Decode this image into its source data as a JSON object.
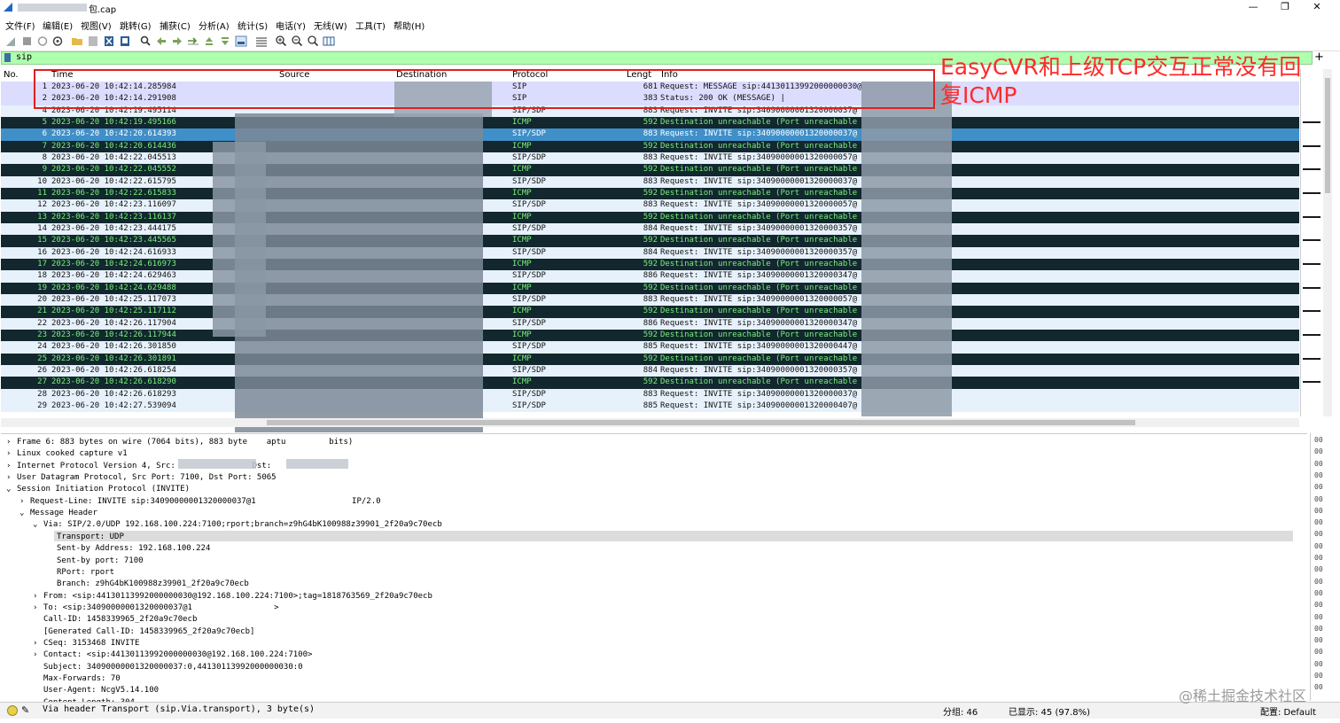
{
  "window": {
    "title": "包.cap",
    "controls": [
      "—",
      "❐",
      "✕"
    ]
  },
  "menu": [
    "文件(F)",
    "编辑(E)",
    "视图(V)",
    "跳转(G)",
    "捕获(C)",
    "分析(A)",
    "统计(S)",
    "电话(Y)",
    "无线(W)",
    "工具(T)",
    "帮助(H)"
  ],
  "filter": {
    "value": "sip",
    "add_label": "+"
  },
  "packet_list": {
    "columns": {
      "no": "No.",
      "time": "Time",
      "source": "Source",
      "destination": "Destination",
      "protocol": "Protocol",
      "length": "Lengt",
      "info": "Info"
    },
    "rows": [
      {
        "no": "1",
        "time": "2023-06-20 10:42:14.285984",
        "proto": "SIP",
        "len": "681",
        "info": "Request: MESSAGE sip:44130113992000000030@",
        "style": "sip"
      },
      {
        "no": "2",
        "time": "2023-06-20 10:42:14.291908",
        "proto": "SIP",
        "len": "383",
        "info": "Status: 200 OK (MESSAGE) |",
        "style": "sip"
      },
      {
        "no": "4",
        "time": "2023-06-20 10:42:19.495114",
        "proto": "SIP/SDP",
        "len": "883",
        "info": "Request: INVITE sip:34090000001320000037@",
        "style": "sip"
      },
      {
        "no": "5",
        "time": "2023-06-20 10:42:19.495166",
        "proto": "ICMP",
        "len": "592",
        "info": "Destination unreachable (Port unreachable",
        "style": "icmp"
      },
      {
        "no": "6",
        "time": "2023-06-20 10:42:20.614393",
        "proto": "SIP/SDP",
        "len": "883",
        "info": "Request: INVITE sip:34090000001320000037@",
        "style": "sel"
      },
      {
        "no": "7",
        "time": "2023-06-20 10:42:20.614436",
        "proto": "ICMP",
        "len": "592",
        "info": "Destination unreachable (Port unreachable",
        "style": "icmp"
      },
      {
        "no": "8",
        "time": "2023-06-20 10:42:22.045513",
        "proto": "SIP/SDP",
        "len": "883",
        "info": "Request: INVITE sip:34090000001320000057@",
        "style": "sip"
      },
      {
        "no": "9",
        "time": "2023-06-20 10:42:22.045552",
        "proto": "ICMP",
        "len": "592",
        "info": "Destination unreachable (Port unreachable",
        "style": "icmp"
      },
      {
        "no": "10",
        "time": "2023-06-20 10:42:22.615795",
        "proto": "SIP/SDP",
        "len": "883",
        "info": "Request: INVITE sip:34090000001320000037@",
        "style": "sip"
      },
      {
        "no": "11",
        "time": "2023-06-20 10:42:22.615833",
        "proto": "ICMP",
        "len": "592",
        "info": "Destination unreachable (Port unreachable",
        "style": "icmp"
      },
      {
        "no": "12",
        "time": "2023-06-20 10:42:23.116097",
        "proto": "SIP/SDP",
        "len": "883",
        "info": "Request: INVITE sip:34090000001320000057@",
        "style": "sip"
      },
      {
        "no": "13",
        "time": "2023-06-20 10:42:23.116137",
        "proto": "ICMP",
        "len": "592",
        "info": "Destination unreachable (Port unreachable",
        "style": "icmp"
      },
      {
        "no": "14",
        "time": "2023-06-20 10:42:23.444175",
        "proto": "SIP/SDP",
        "len": "884",
        "info": "Request: INVITE sip:34090000001320000357@",
        "style": "sip"
      },
      {
        "no": "15",
        "time": "2023-06-20 10:42:23.445565",
        "proto": "ICMP",
        "len": "592",
        "info": "Destination unreachable (Port unreachable",
        "style": "icmp"
      },
      {
        "no": "16",
        "time": "2023-06-20 10:42:24.616933",
        "proto": "SIP/SDP",
        "len": "884",
        "info": "Request: INVITE sip:34090000001320000357@",
        "style": "sip"
      },
      {
        "no": "17",
        "time": "2023-06-20 10:42:24.616973",
        "proto": "ICMP",
        "len": "592",
        "info": "Destination unreachable (Port unreachable",
        "style": "icmp"
      },
      {
        "no": "18",
        "time": "2023-06-20 10:42:24.629463",
        "proto": "SIP/SDP",
        "len": "886",
        "info": "Request: INVITE sip:34090000001320000347@",
        "style": "sip"
      },
      {
        "no": "19",
        "time": "2023-06-20 10:42:24.629488",
        "proto": "ICMP",
        "len": "592",
        "info": "Destination unreachable (Port unreachable",
        "style": "icmp"
      },
      {
        "no": "20",
        "time": "2023-06-20 10:42:25.117073",
        "proto": "SIP/SDP",
        "len": "883",
        "info": "Request: INVITE sip:34090000001320000057@",
        "style": "sip"
      },
      {
        "no": "21",
        "time": "2023-06-20 10:42:25.117112",
        "proto": "ICMP",
        "len": "592",
        "info": "Destination unreachable (Port unreachable",
        "style": "icmp"
      },
      {
        "no": "22",
        "time": "2023-06-20 10:42:26.117904",
        "proto": "SIP/SDP",
        "len": "886",
        "info": "Request: INVITE sip:34090000001320000347@",
        "style": "sip"
      },
      {
        "no": "23",
        "time": "2023-06-20 10:42:26.117944",
        "proto": "ICMP",
        "len": "592",
        "info": "Destination unreachable (Port unreachable",
        "style": "icmp"
      },
      {
        "no": "24",
        "time": "2023-06-20 10:42:26.301850",
        "proto": "SIP/SDP",
        "len": "885",
        "info": "Request: INVITE sip:34090000001320000447@",
        "style": "sip"
      },
      {
        "no": "25",
        "time": "2023-06-20 10:42:26.301891",
        "proto": "ICMP",
        "len": "592",
        "info": "Destination unreachable (Port unreachable",
        "style": "icmp"
      },
      {
        "no": "26",
        "time": "2023-06-20 10:42:26.618254",
        "proto": "SIP/SDP",
        "len": "884",
        "info": "Request: INVITE sip:34090000001320000357@",
        "style": "sip"
      },
      {
        "no": "27",
        "time": "2023-06-20 10:42:26.618290",
        "proto": "ICMP",
        "len": "592",
        "info": "Destination unreachable (Port unreachable",
        "style": "icmp"
      },
      {
        "no": "28",
        "time": "2023-06-20 10:42:26.618293",
        "proto": "SIP/SDP",
        "len": "883",
        "info": "Request: INVITE sip:34090000001320000037@",
        "style": "sip"
      },
      {
        "no": "29",
        "time": "2023-06-20 10:42:27.539094",
        "proto": "SIP/SDP",
        "len": "885",
        "info": "Request: INVITE sip:34090000001320000407@",
        "style": "sip"
      }
    ]
  },
  "annotation": {
    "text": "EasyCVR和上级TCP交互正常没有回复ICMP",
    "color": "#ff2a2a"
  },
  "details": [
    {
      "indent": 0,
      "arrow": "›",
      "text": "Frame 6: 883 bytes on wire (7064 bits), 883 byte    aptu         bits)"
    },
    {
      "indent": 0,
      "arrow": "›",
      "text": "Linux cooked capture v1"
    },
    {
      "indent": 0,
      "arrow": "›",
      "text": "Internet Protocol Version 4, Src:                Dst:"
    },
    {
      "indent": 0,
      "arrow": "›",
      "text": "User Datagram Protocol, Src Port: 7100, Dst Port: 5065"
    },
    {
      "indent": 0,
      "arrow": "⌄",
      "text": "Session Initiation Protocol (INVITE)"
    },
    {
      "indent": 1,
      "arrow": "›",
      "text": "Request-Line: INVITE sip:34090000001320000037@1                    IP/2.0"
    },
    {
      "indent": 1,
      "arrow": "⌄",
      "text": "Message Header"
    },
    {
      "indent": 2,
      "arrow": "⌄",
      "text": "Via: SIP/2.0/UDP 192.168.100.224:7100;rport;branch=z9hG4bK100988z39901_2f20a9c70ecb"
    },
    {
      "indent": 3,
      "arrow": "",
      "text": "Transport: UDP"
    },
    {
      "indent": 3,
      "arrow": "",
      "text": "Sent-by Address: 192.168.100.224"
    },
    {
      "indent": 3,
      "arrow": "",
      "text": "Sent-by port: 7100"
    },
    {
      "indent": 3,
      "arrow": "",
      "text": "RPort: rport"
    },
    {
      "indent": 3,
      "arrow": "",
      "text": "Branch: z9hG4bK100988z39901_2f20a9c70ecb"
    },
    {
      "indent": 2,
      "arrow": "›",
      "text": "From: <sip:44130113992000000030@192.168.100.224:7100>;tag=1818763569_2f20a9c70ecb"
    },
    {
      "indent": 2,
      "arrow": "›",
      "text": "To: <sip:34090000001320000037@1                 >"
    },
    {
      "indent": 2,
      "arrow": "",
      "text": "Call-ID: 1458339965_2f20a9c70ecb"
    },
    {
      "indent": 2,
      "arrow": "",
      "text": "[Generated Call-ID: 1458339965_2f20a9c70ecb]"
    },
    {
      "indent": 2,
      "arrow": "›",
      "text": "CSeq: 3153468 INVITE"
    },
    {
      "indent": 2,
      "arrow": "›",
      "text": "Contact: <sip:44130113992000000030@192.168.100.224:7100>"
    },
    {
      "indent": 2,
      "arrow": "",
      "text": "Subject: 34090000001320000037:0,44130113992000000030:0"
    },
    {
      "indent": 2,
      "arrow": "",
      "text": "Max-Forwards: 70"
    },
    {
      "indent": 2,
      "arrow": "",
      "text": "User-Agent: NcgV5.14.100"
    },
    {
      "indent": 2,
      "arrow": "",
      "text": "Content-Length: 304"
    }
  ],
  "bytes_pane": [
    "00",
    "00",
    "00",
    "00",
    "00",
    "00",
    "00",
    "00",
    "00",
    "00",
    "00",
    "00",
    "00",
    "00",
    "00",
    "00",
    "00",
    "00",
    "00",
    "00",
    "00",
    "00"
  ],
  "status": {
    "message": "Via header Transport (sip.Via.transport), 3 byte(s)",
    "groups": "分组: 46",
    "displayed": "已显示: 45 (97.8%)",
    "profile": "配置: Default",
    "watermark": "@稀土掘金技术社区"
  }
}
